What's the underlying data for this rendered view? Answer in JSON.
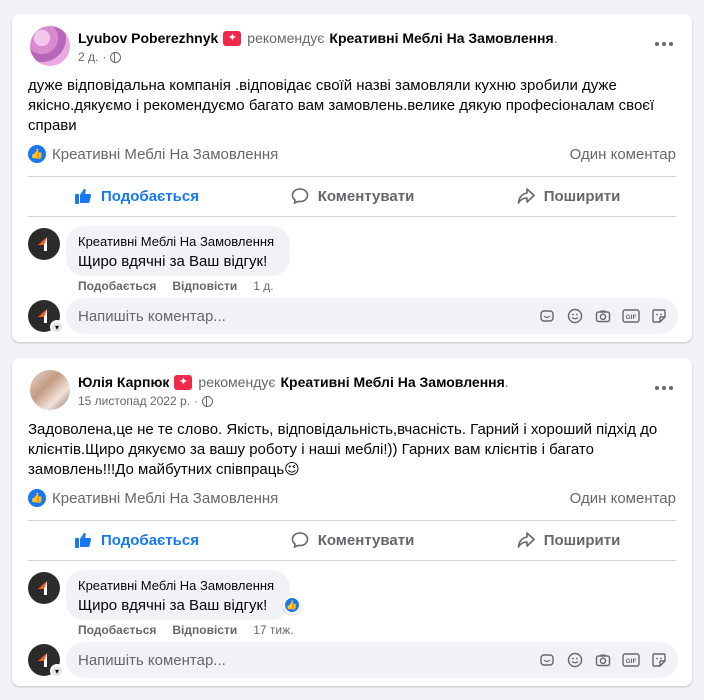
{
  "posts": [
    {
      "author": "Lyubov Poberezhnyk",
      "recommends": "рекомендує",
      "page": "Креативні Меблі На Замовлення",
      "time": "2 д.",
      "text": "дуже відповідальна компанія .відповідає своїй назві замовляли кухню зробили  дуже якісно.дякуємо і рекомендуємо багато вам замовлень.велике дякую професіоналам своєї справи",
      "reaction_by": "Креативні Меблі На Замовлення",
      "comments_count": "Один коментар",
      "reply": {
        "name": "Креативні Меблі На Замовлення",
        "text": "Щиро вдячні за Ваш відгук!",
        "like": "Подобається",
        "reply": "Відповісти",
        "time": "1 д."
      }
    },
    {
      "author": "Юлія Карпюк",
      "recommends": "рекомендує",
      "page": "Креативні Меблі На Замовлення",
      "time": "15 листопад 2022 р.",
      "text": "Задоволена,це не те слово. Якість, відповідальність,вчасність. Гарний і хороший підхід до клієнтів.Щиро дякуємо за вашу роботу і наші меблі!)) Гарних вам клієнтів і багато замовлень!!!До майбутних співпраць😉",
      "reaction_by": "Креативні Меблі На Замовлення",
      "comments_count": "Один коментар",
      "reply": {
        "name": "Креативні Меблі На Замовлення",
        "text": "Щиро вдячні за Ваш відгук!",
        "like": "Подобається",
        "reply": "Відповісти",
        "time": "17 тиж."
      }
    }
  ],
  "actions": {
    "like": "Подобається",
    "comment": "Коментувати",
    "share": "Поширити"
  },
  "comment_placeholder": "Напишіть коментар...",
  "colors": {
    "accent": "#1877f2",
    "badge": "#f02849",
    "muted": "#65676b",
    "background": "#f0f2f5"
  },
  "icons": [
    "more-icon",
    "globe-icon",
    "like-icon",
    "comment-icon",
    "share-icon",
    "sticker-icon",
    "emoji-icon",
    "camera-icon",
    "gif-icon",
    "avatar-icon"
  ]
}
